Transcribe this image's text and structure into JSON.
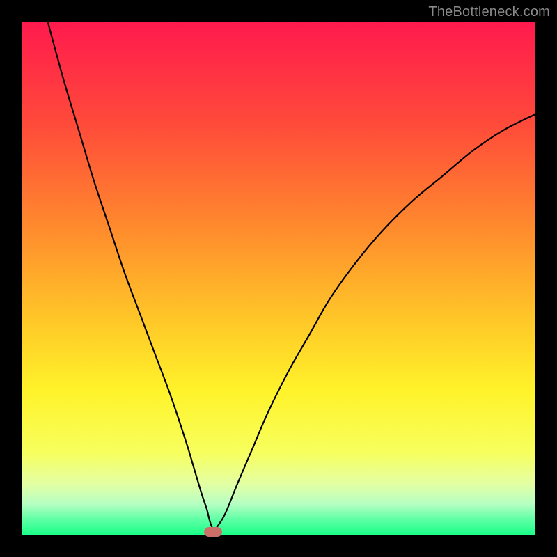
{
  "watermark": "TheBottleneck.com",
  "chart_data": {
    "type": "line",
    "title": "",
    "xlabel": "",
    "ylabel": "",
    "xlim": [
      0,
      100
    ],
    "ylim": [
      0,
      100
    ],
    "grid": false,
    "series": [
      {
        "name": "curve",
        "color": "#000000",
        "x": [
          5,
          8,
          11,
          14,
          17,
          20,
          23,
          26,
          29,
          32,
          33.5,
          35,
          36,
          36.5,
          37,
          37.5,
          38,
          39,
          40,
          42,
          45,
          48,
          52,
          56,
          60,
          65,
          70,
          76,
          82,
          88,
          94,
          100
        ],
        "values": [
          100,
          89,
          79,
          69,
          60,
          51,
          43,
          35,
          27,
          18,
          13,
          8,
          5,
          3,
          1.5,
          0.8,
          1.5,
          3,
          5,
          10,
          17,
          24,
          32,
          39,
          46,
          53,
          59,
          65,
          70,
          75,
          79,
          82
        ]
      }
    ],
    "background_gradient": {
      "stops": [
        {
          "offset": 0.0,
          "color": "#ff1a4d"
        },
        {
          "offset": 0.2,
          "color": "#ff4b3a"
        },
        {
          "offset": 0.4,
          "color": "#ff8a2d"
        },
        {
          "offset": 0.58,
          "color": "#ffc728"
        },
        {
          "offset": 0.72,
          "color": "#fff32a"
        },
        {
          "offset": 0.84,
          "color": "#f7ff5e"
        },
        {
          "offset": 0.9,
          "color": "#e4ffa3"
        },
        {
          "offset": 0.94,
          "color": "#b6ffc3"
        },
        {
          "offset": 0.97,
          "color": "#5effa5"
        },
        {
          "offset": 1.0,
          "color": "#1aff88"
        }
      ]
    },
    "marker": {
      "x": 37.2,
      "y": 0.6,
      "color": "#cb6f68"
    }
  }
}
